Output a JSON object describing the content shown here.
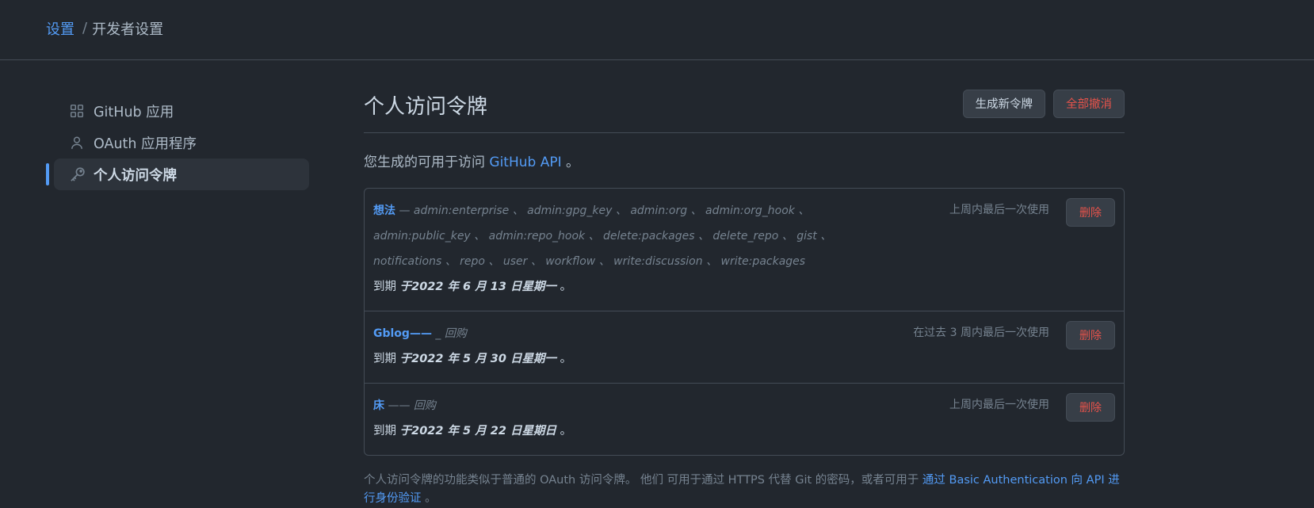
{
  "breadcrumb": {
    "root": "设置",
    "separator": "/",
    "current": "开发者设置"
  },
  "sidebar": {
    "items": [
      {
        "label": "GitHub 应用",
        "icon": "apps-grid-icon"
      },
      {
        "label": "OAuth 应用程序",
        "icon": "person-icon"
      },
      {
        "label": "个人访问令牌",
        "icon": "key-icon",
        "active": true
      }
    ]
  },
  "main": {
    "title": "个人访问令牌",
    "generate_button": "生成新令牌",
    "revoke_all_button": "全部撤消",
    "intro_prefix": "您生成的可用于访问",
    "intro_link": "GitHub API",
    "intro_suffix": " 。"
  },
  "tokens": [
    {
      "name": "想法",
      "dash": " — ",
      "scopes": "admin:enterprise 、 admin:gpg_key 、 admin:org 、 admin:org_hook 、 admin:public_key 、 admin:repo_hook 、 delete:packages 、 delete_repo 、 gist 、 notifications 、 repo 、 user 、 workflow 、 write:discussion 、 write:packages",
      "expires_label": "到期",
      "expires_date": "于2022 年 6 月 13 日星期一",
      "expires_end": " 。",
      "last_used": "上周内最后一次使用",
      "delete_label": "删除"
    },
    {
      "name": "Gblog——",
      "dash": " _ ",
      "scopes": "回购",
      "expires_label": "到期",
      "expires_date": "于2022 年 5 月 30 日星期一",
      "expires_end": " 。",
      "last_used": "在过去 3 周内最后一次使用",
      "delete_label": "删除"
    },
    {
      "name": "床",
      "dash": " —— ",
      "scopes": "回购",
      "expires_label": "到期",
      "expires_date": "于2022 年 5 月 22 日星期日",
      "expires_end": " 。",
      "last_used": "上周内最后一次使用",
      "delete_label": "删除"
    }
  ],
  "note": {
    "text": "个人访问令牌的功能类似于普通的 OAuth 访问令牌。 他们 可用于通过 HTTPS 代替 Git 的密码，或者可用于 ",
    "link": "通过 Basic Authentication 向 API 进行身份验证",
    "end": " 。"
  }
}
